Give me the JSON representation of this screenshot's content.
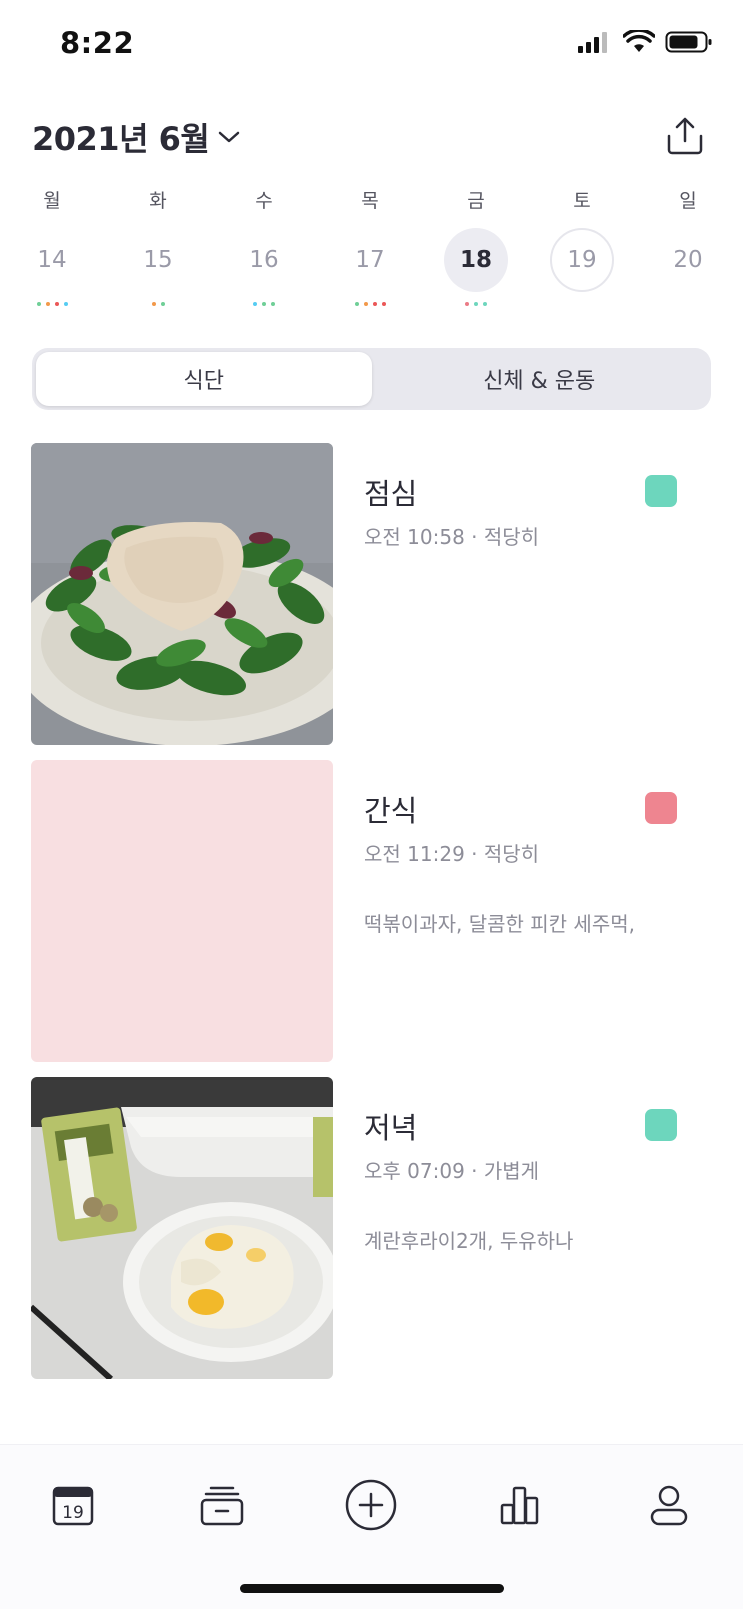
{
  "status_bar": {
    "time": "8:22"
  },
  "header": {
    "month": "2021년 6월"
  },
  "week": {
    "days": [
      {
        "name": "월",
        "num": "14",
        "dots": [
          "#6fcf97",
          "#f2994a",
          "#eb5757",
          "#56ccf2"
        ]
      },
      {
        "name": "화",
        "num": "15",
        "dots": [
          "#f2994a",
          "#6fcf97"
        ]
      },
      {
        "name": "수",
        "num": "16",
        "dots": [
          "#56ccf2",
          "#6fcf97",
          "#6fcf97"
        ]
      },
      {
        "name": "목",
        "num": "17",
        "dots": [
          "#6fcf97",
          "#f2994a",
          "#eb5757",
          "#eb5757"
        ]
      },
      {
        "name": "금",
        "num": "18",
        "dots": [
          "#eb7b86",
          "#6dd6bd",
          "#6dd6bd"
        ]
      },
      {
        "name": "토",
        "num": "19",
        "dots": []
      },
      {
        "name": "일",
        "num": "20",
        "dots": []
      }
    ]
  },
  "segment": {
    "tab1": "식단",
    "tab2": "신체 & 운동"
  },
  "meals": [
    {
      "title": "점심",
      "meta": "오전 10:58 · 적당히",
      "desc": "",
      "tag_color": "#6dd6bd"
    },
    {
      "title": "간식",
      "meta": "오전 11:29 · 적당히",
      "desc": "떡볶이과자, 달콤한 피칸 세주먹,",
      "tag_color": "#ee8590"
    },
    {
      "title": "저녁",
      "meta": "오후 07:09 · 가볍게",
      "desc": "계란후라이2개, 두유하나",
      "tag_color": "#6dd6bd"
    }
  ],
  "tab_bar": {
    "calendar_day": "19"
  },
  "colors": {
    "accent_green": "#6dd6bd",
    "accent_pink": "#ee8590",
    "snack_placeholder": "#f8dfe1"
  }
}
